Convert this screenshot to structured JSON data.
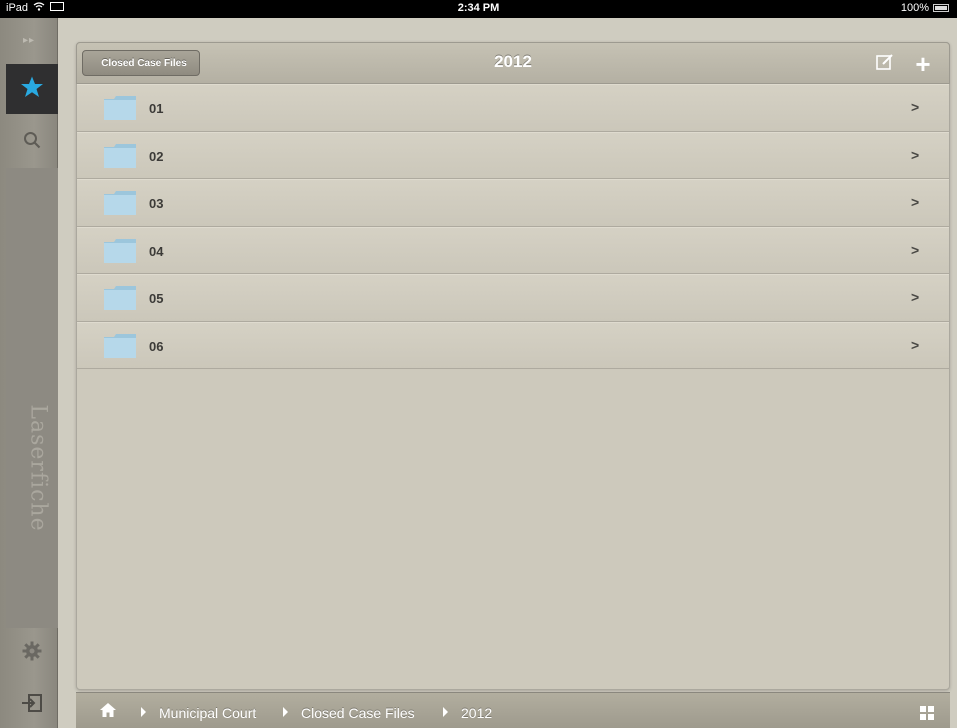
{
  "status_bar": {
    "device": "iPad",
    "time": "2:34 PM",
    "battery": "100%"
  },
  "sidebar": {
    "brand": "Laserfiche",
    "items": [
      {
        "name": "expand",
        "icon": "double-chevron-right-icon"
      },
      {
        "name": "favorites",
        "icon": "star-icon",
        "selected": true
      },
      {
        "name": "search",
        "icon": "search-icon"
      },
      {
        "name": "settings",
        "icon": "gear-icon"
      },
      {
        "name": "logout",
        "icon": "logout-icon"
      }
    ],
    "expand_glyph": "▸▸"
  },
  "navbar": {
    "back_label": "Closed Case Files",
    "title": "2012",
    "edit_icon": "edit-icon",
    "add_icon": "plus-icon",
    "add_glyph": "+"
  },
  "folders": [
    {
      "label": "01"
    },
    {
      "label": "02"
    },
    {
      "label": "03"
    },
    {
      "label": "04"
    },
    {
      "label": "05"
    },
    {
      "label": "06"
    }
  ],
  "breadcrumb": {
    "home_icon": "home-icon",
    "items": [
      "Municipal Court",
      "Closed Case Files",
      "2012"
    ],
    "view_icon": "grid-view-icon"
  },
  "colors": {
    "accent": "#29a9e0",
    "panel": "#cdc9bc",
    "sidebar": "#8d8a82"
  }
}
